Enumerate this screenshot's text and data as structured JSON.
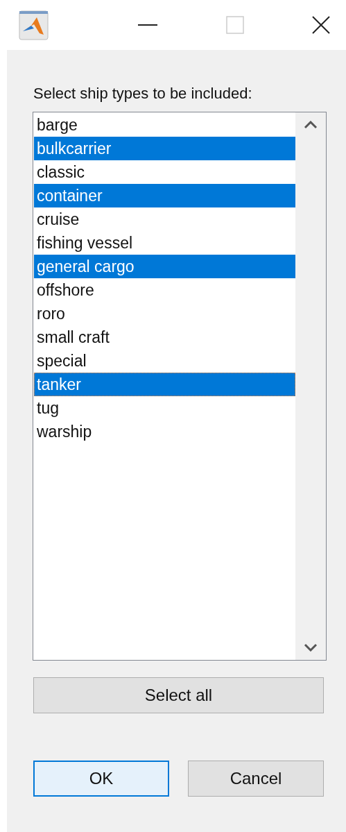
{
  "prompt": "Select ship types to be included:",
  "items": [
    {
      "label": "barge",
      "selected": false,
      "focused": false
    },
    {
      "label": "bulkcarrier",
      "selected": true,
      "focused": false
    },
    {
      "label": "classic",
      "selected": false,
      "focused": false
    },
    {
      "label": "container",
      "selected": true,
      "focused": false
    },
    {
      "label": "cruise",
      "selected": false,
      "focused": false
    },
    {
      "label": "fishing vessel",
      "selected": false,
      "focused": false
    },
    {
      "label": "general cargo",
      "selected": true,
      "focused": false
    },
    {
      "label": "offshore",
      "selected": false,
      "focused": false
    },
    {
      "label": "roro",
      "selected": false,
      "focused": false
    },
    {
      "label": "small craft",
      "selected": false,
      "focused": false
    },
    {
      "label": "special",
      "selected": false,
      "focused": false
    },
    {
      "label": "tanker",
      "selected": true,
      "focused": true
    },
    {
      "label": "tug",
      "selected": false,
      "focused": false
    },
    {
      "label": "warship",
      "selected": false,
      "focused": false
    }
  ],
  "select_all": "Select all",
  "buttons": [
    {
      "label": "OK",
      "default": true
    },
    {
      "label": "Cancel",
      "default": false
    }
  ]
}
